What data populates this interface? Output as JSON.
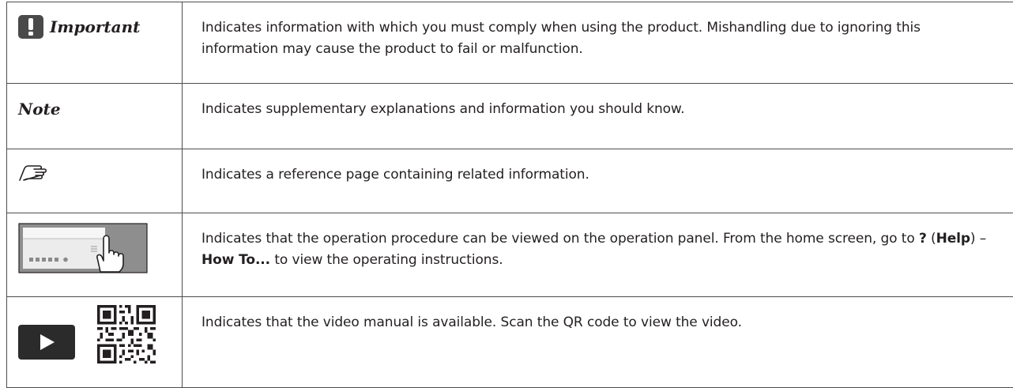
{
  "rows": [
    {
      "symbol_label": "Important",
      "icon": "exclamation-icon",
      "description": "Indicates information with which you must comply when using the product. Mishandling due to ignoring this information may cause the product to fail or malfunction."
    },
    {
      "symbol_label": "Note",
      "description": "Indicates supplementary explanations and information you should know."
    },
    {
      "icon": "pointing-hand-reference-icon",
      "description": "Indicates a reference page containing related information."
    },
    {
      "icon": "operation-panel-touch-icon",
      "description_parts": {
        "text1": "Indicates that the operation procedure can be viewed on the operation panel. From the home screen, go to ",
        "help_symbol": "?",
        "text2": " (",
        "help_label": "Help",
        "text3": ") – ",
        "howto_label": "How To...",
        "text4": " to view the operating instructions."
      }
    },
    {
      "icon": "video-play-icon",
      "icon2": "qr-code-icon",
      "description": "Indicates that the video manual is available. Scan the QR code to view the video."
    }
  ],
  "colors": {
    "border": "#4d4d4d",
    "text": "#231f20",
    "icon_dark": "#4a4a4a"
  }
}
